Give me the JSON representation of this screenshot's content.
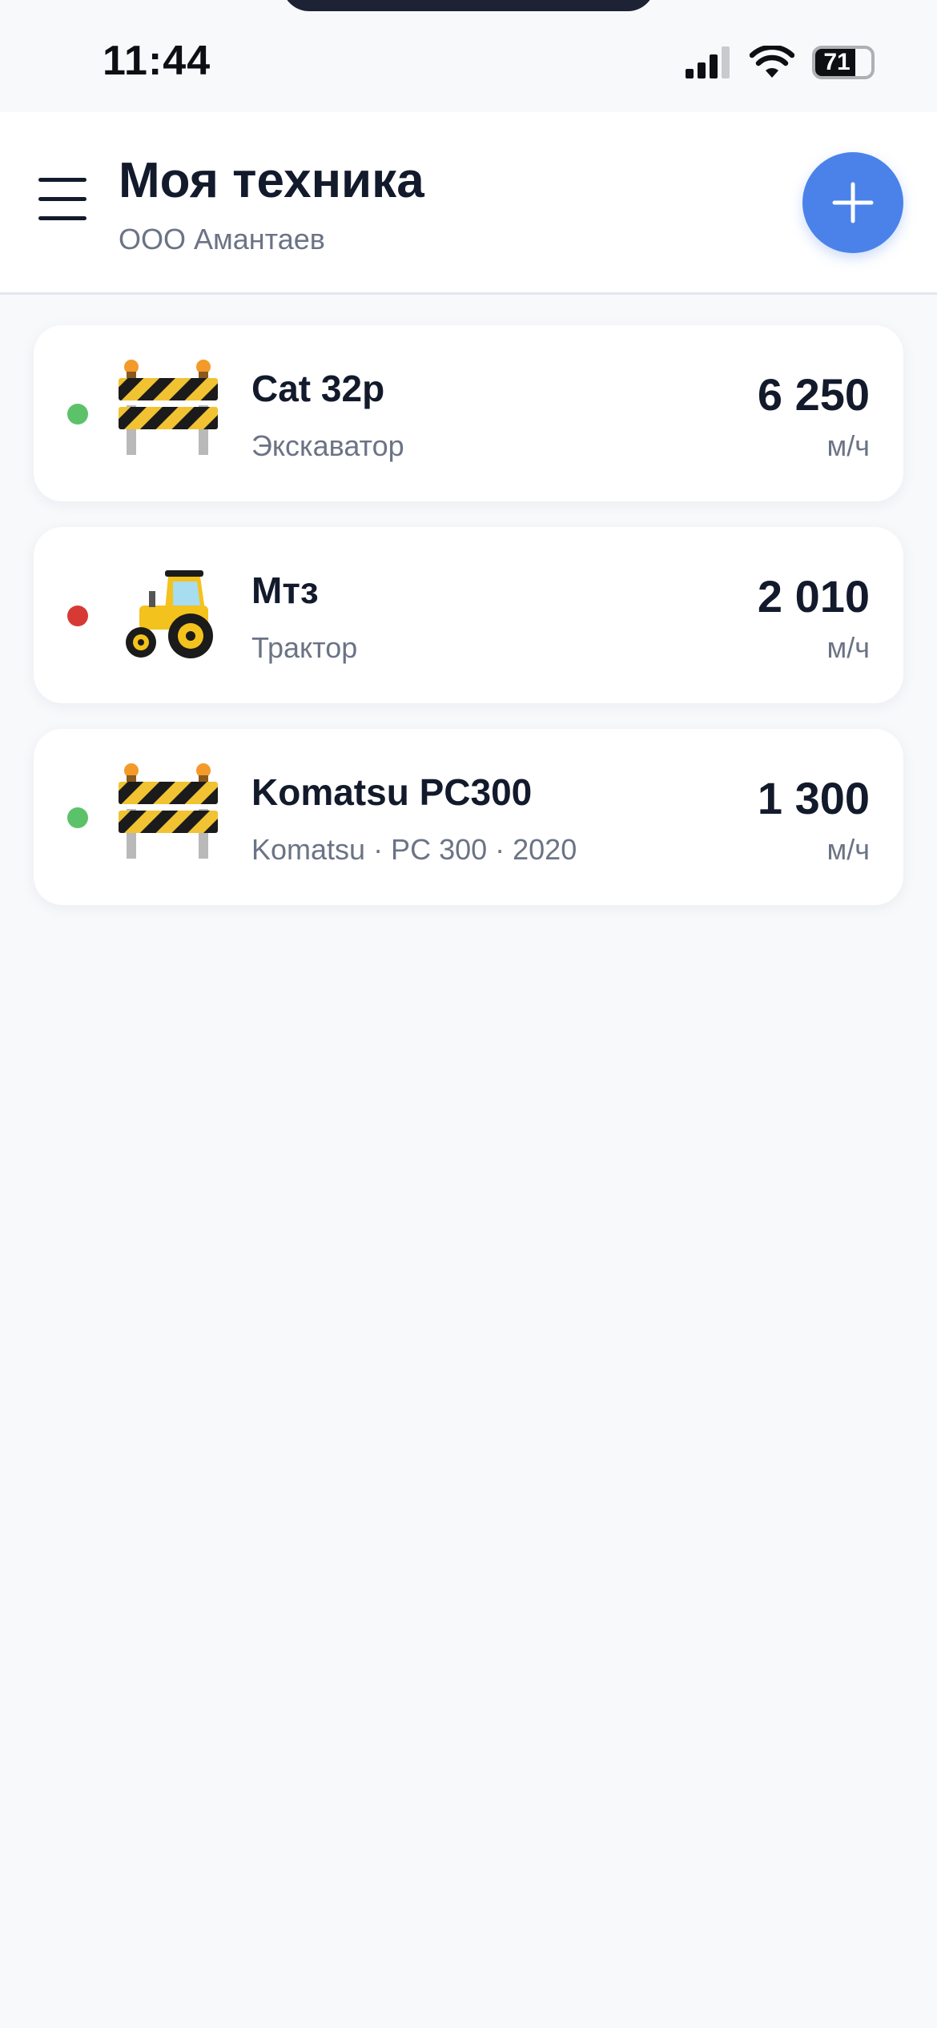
{
  "status_bar": {
    "time": "11:44",
    "battery": "71",
    "icons": [
      "signal-icon",
      "wifi-icon",
      "battery-icon"
    ]
  },
  "header": {
    "title": "Моя техника",
    "subtitle": "ООО Амантаев",
    "menu_icon": "hamburger-menu-icon",
    "add_icon": "plus-icon"
  },
  "colors": {
    "accent": "#4a82ea",
    "status_active": "#5cc26a",
    "status_inactive": "#d73a34",
    "text_primary": "#121a2c",
    "text_secondary": "#6b7385"
  },
  "equipment": [
    {
      "name": "Cat 32p",
      "subtitle": "Экскаватор",
      "value": "6 250",
      "unit": "м/ч",
      "status": "active",
      "icon": "construction-barrier-icon"
    },
    {
      "name": "Мтз",
      "subtitle": "Трактор",
      "value": "2 010",
      "unit": "м/ч",
      "status": "inactive",
      "icon": "tractor-icon"
    },
    {
      "name": "Komatsu PC300",
      "subtitle": "Komatsu · PC 300 · 2020",
      "value": "1 300",
      "unit": "м/ч",
      "status": "active",
      "icon": "construction-barrier-icon"
    }
  ]
}
